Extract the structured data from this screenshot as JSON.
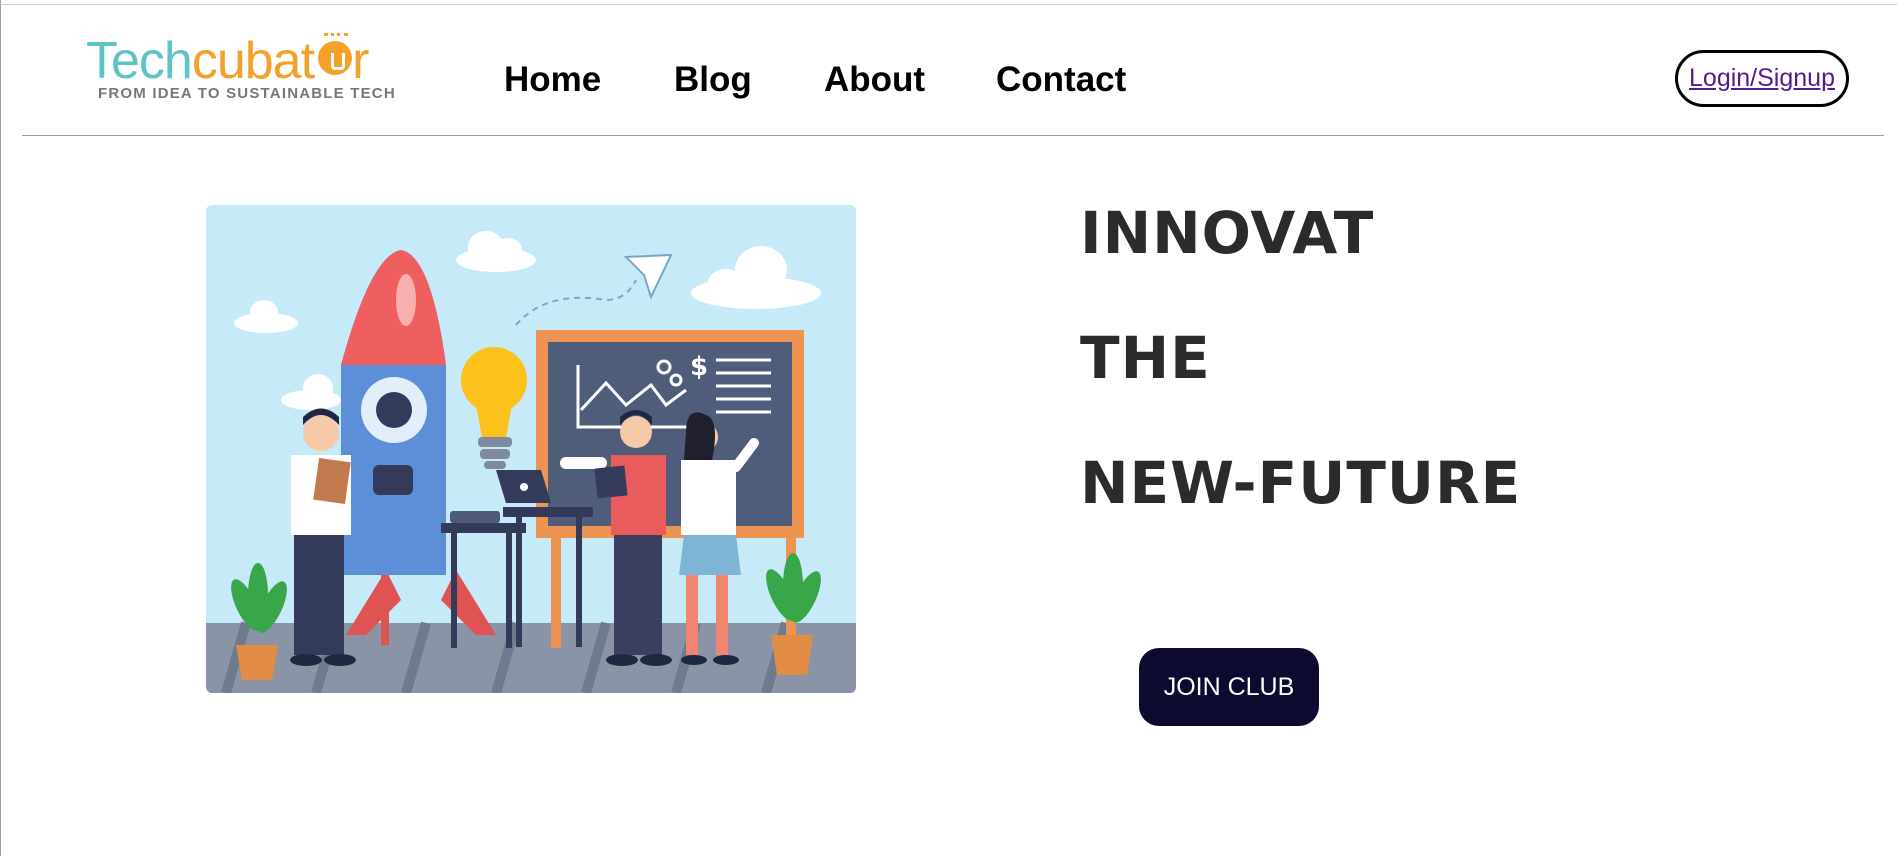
{
  "logo": {
    "text_teal": "Tech",
    "text_orange": "cubat",
    "text_orange_end": "r",
    "tagline": "FROM IDEA TO SUSTAINABLE TECH",
    "colors": {
      "teal": "#5fc4c6",
      "orange": "#f4a12a"
    }
  },
  "nav": {
    "items": [
      {
        "label": "Home"
      },
      {
        "label": "Blog"
      },
      {
        "label": "About"
      },
      {
        "label": "Contact"
      }
    ]
  },
  "auth": {
    "label": "Login/Signup"
  },
  "hero": {
    "illustration": "startup-team-rocket-illustration",
    "lines": [
      "INNOVAT",
      "THE",
      "NEW-FUTURE"
    ],
    "cta_label": "JOIN CLUB"
  },
  "colors": {
    "cta_background": "#0c0a2e",
    "headline": "#2b2b2b",
    "link_visited": "#551a8b"
  }
}
